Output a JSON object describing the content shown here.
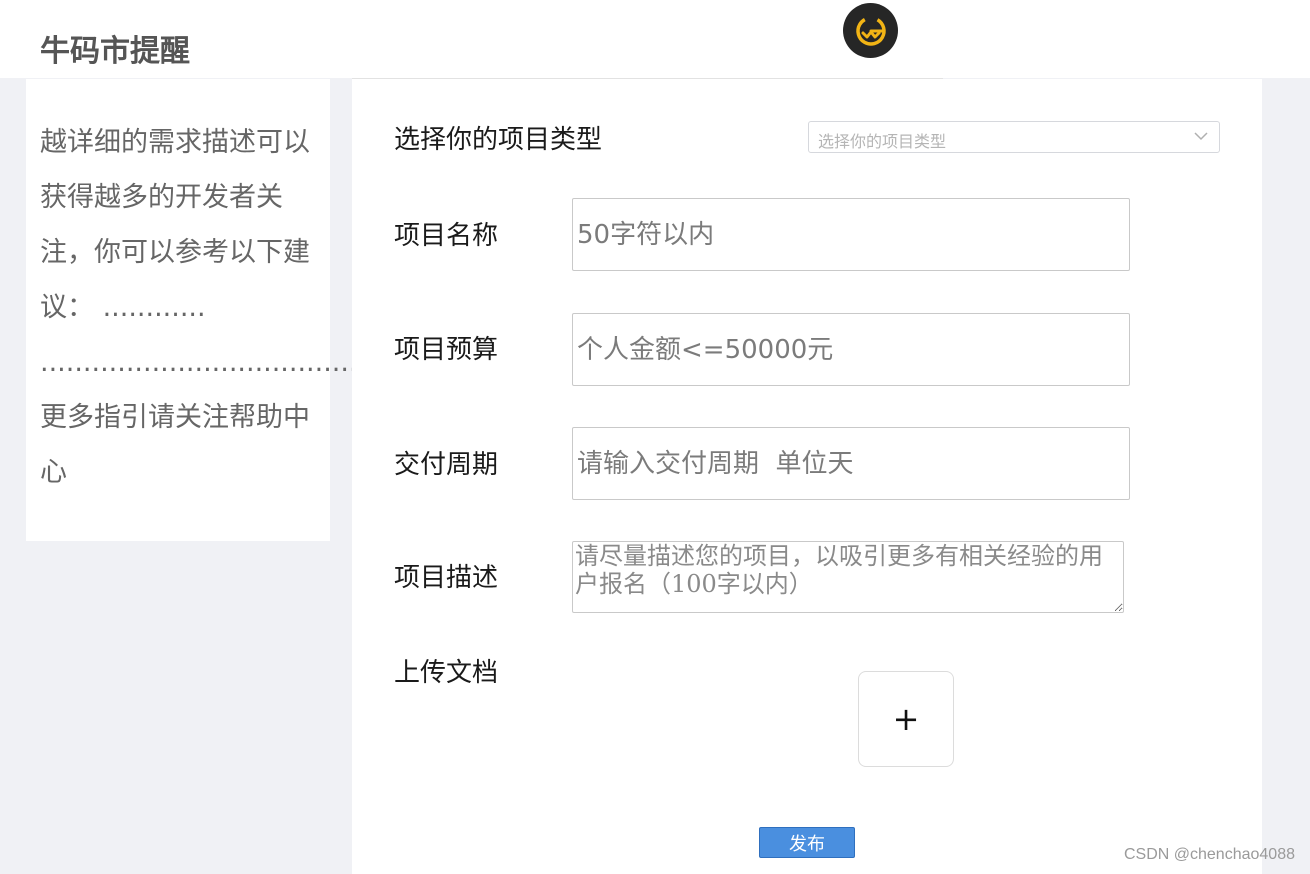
{
  "header": {
    "title": "牛码市提醒",
    "logo_icon": "brand-logo-icon"
  },
  "sidebar": {
    "text": "越详细的需求描述可以获得越多的开发者关注，你可以参考以下建议： ............ ......................................更多指引请关注帮助中心"
  },
  "form": {
    "project_type_label": "选择你的项目类型",
    "project_type_placeholder": "选择你的项目类型",
    "name_label": "项目名称",
    "name_placeholder": "50字符以内",
    "budget_label": "项目预算",
    "budget_placeholder": "个人金额<=50000元",
    "period_label": "交付周期",
    "period_placeholder": "请输入交付周期  单位天",
    "desc_label": "项目描述",
    "desc_placeholder": "请尽量描述您的项目，以吸引更多有相关经验的用户报名（100字以内）",
    "upload_label": "上传文档",
    "upload_plus": "+",
    "publish_label": "发布"
  },
  "watermark": "CSDN @chenchao4088",
  "colors": {
    "page_bg": "#f0f1f5",
    "button_blue": "#4a8fdf",
    "logo_bg": "#262626",
    "logo_accent": "#f2b415"
  }
}
